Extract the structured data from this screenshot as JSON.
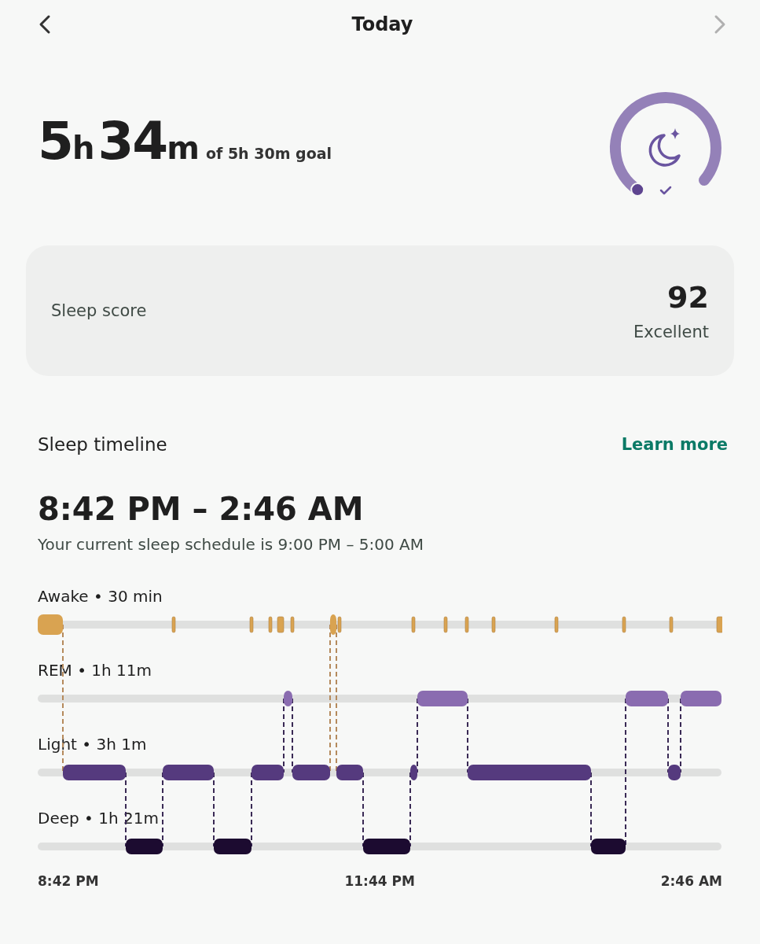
{
  "nav": {
    "title": "Today",
    "back_disabled": false,
    "next_disabled": true
  },
  "duration": {
    "hours": "5",
    "hours_unit": "h",
    "minutes": "34",
    "minutes_unit": "m",
    "goal": "of 5h 30m goal"
  },
  "score": {
    "label": "Sleep score",
    "value": "92",
    "rating": "Excellent"
  },
  "timeline": {
    "title": "Sleep timeline",
    "link": "Learn more",
    "range": "8:42 PM – 2:46 AM",
    "schedule": "Your current sleep schedule is 9:00 PM – 5:00 AM",
    "stages": [
      {
        "kind": "awake",
        "label": "Awake • 30 min"
      },
      {
        "kind": "rem",
        "label": "REM • 1h 11m"
      },
      {
        "kind": "light",
        "label": "Light • 3h 1m"
      },
      {
        "kind": "deep",
        "label": "Deep • 1h 21m"
      }
    ],
    "axis": [
      "8:42 PM",
      "11:44 PM",
      "2:46 AM"
    ]
  }
}
